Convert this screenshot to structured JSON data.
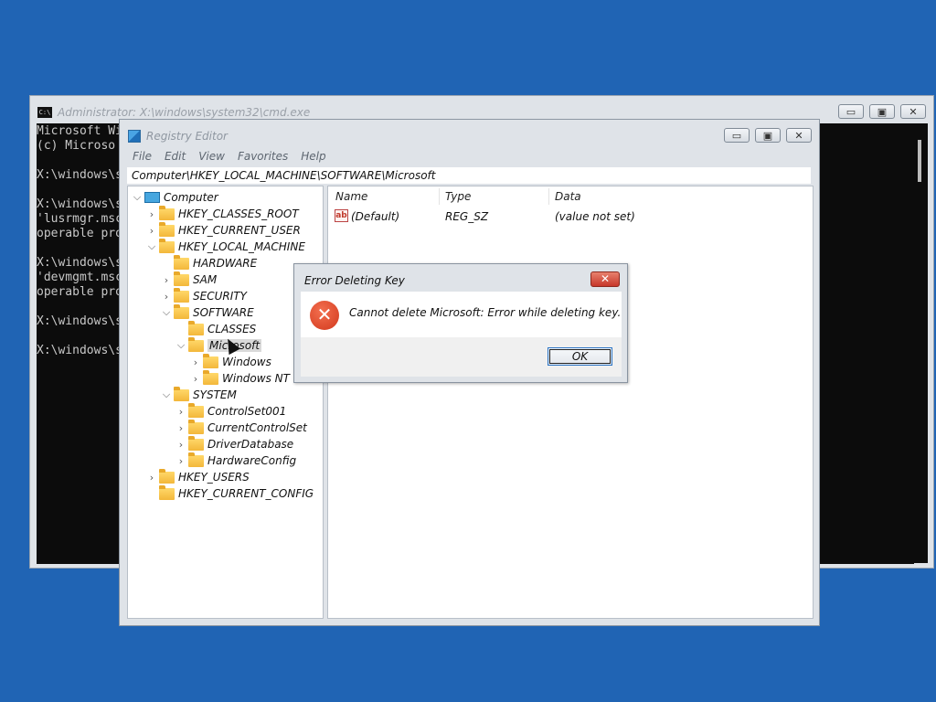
{
  "cmd": {
    "title": "Administrator: X:\\windows\\system32\\cmd.exe",
    "icon_text": "C:\\",
    "lines": [
      "Microsoft Wi",
      "(c) Microso",
      "",
      "X:\\windows\\s",
      "",
      "X:\\windows\\s",
      "'lusrmgr.msc",
      "operable pro",
      "",
      "X:\\windows\\s",
      "'devmgmt.msc",
      "operable pro",
      "",
      "X:\\windows\\s",
      "",
      "X:\\windows\\s"
    ],
    "window_buttons": {
      "minimize": "▭",
      "maximize": "▣",
      "close": "✕"
    }
  },
  "regedit": {
    "title": "Registry Editor",
    "menu": [
      "File",
      "Edit",
      "View",
      "Favorites",
      "Help"
    ],
    "address": "Computer\\HKEY_LOCAL_MACHINE\\SOFTWARE\\Microsoft",
    "window_buttons": {
      "minimize": "▭",
      "maximize": "▣",
      "close": "✕"
    },
    "tree": [
      {
        "label": "Computer",
        "icon": "computer-icon",
        "expander": "expanded"
      },
      {
        "label": "HKEY_CLASSES_ROOT",
        "icon": "folder-icon",
        "expander": "collapsed"
      },
      {
        "label": "HKEY_CURRENT_USER",
        "icon": "folder-icon",
        "expander": "collapsed"
      },
      {
        "label": "HKEY_LOCAL_MACHINE",
        "icon": "folder-icon",
        "expander": "expanded"
      },
      {
        "label": "HARDWARE",
        "icon": "folder-icon",
        "expander": "none"
      },
      {
        "label": "SAM",
        "icon": "folder-icon",
        "expander": "collapsed"
      },
      {
        "label": "SECURITY",
        "icon": "folder-icon",
        "expander": "collapsed"
      },
      {
        "label": "SOFTWARE",
        "icon": "folder-icon",
        "expander": "expanded"
      },
      {
        "label": "CLASSES",
        "icon": "folder-icon",
        "expander": "none"
      },
      {
        "label": "Microsoft",
        "icon": "folder-icon",
        "expander": "expanded",
        "selected": true
      },
      {
        "label": "Windows",
        "icon": "folder-icon",
        "expander": "collapsed"
      },
      {
        "label": "Windows NT",
        "icon": "folder-icon",
        "expander": "collapsed"
      },
      {
        "label": "SYSTEM",
        "icon": "folder-icon",
        "expander": "expanded"
      },
      {
        "label": "ControlSet001",
        "icon": "folder-icon",
        "expander": "collapsed"
      },
      {
        "label": "CurrentControlSet",
        "icon": "folder-icon",
        "expander": "collapsed"
      },
      {
        "label": "DriverDatabase",
        "icon": "folder-icon",
        "expander": "collapsed"
      },
      {
        "label": "HardwareConfig",
        "icon": "folder-icon",
        "expander": "collapsed"
      },
      {
        "label": "HKEY_USERS",
        "icon": "folder-icon",
        "expander": "collapsed"
      },
      {
        "label": "HKEY_CURRENT_CONFIG",
        "icon": "folder-icon",
        "expander": "none"
      }
    ],
    "columns": [
      "Name",
      "Type",
      "Data"
    ],
    "rows": [
      {
        "icon": "string-value-icon",
        "icon_text": "ab",
        "name": "(Default)",
        "type": "REG_SZ",
        "data": "(value not set)"
      }
    ]
  },
  "dialog": {
    "title": "Error Deleting Key",
    "close_label": "✕",
    "icon_symbol": "✕",
    "message": "Cannot delete Microsoft:  Error while deleting key.",
    "ok_label": "OK"
  },
  "colors": {
    "desktop": "#2064b4",
    "console_bg": "#0c0c0c",
    "error_red": "#d2381c"
  }
}
